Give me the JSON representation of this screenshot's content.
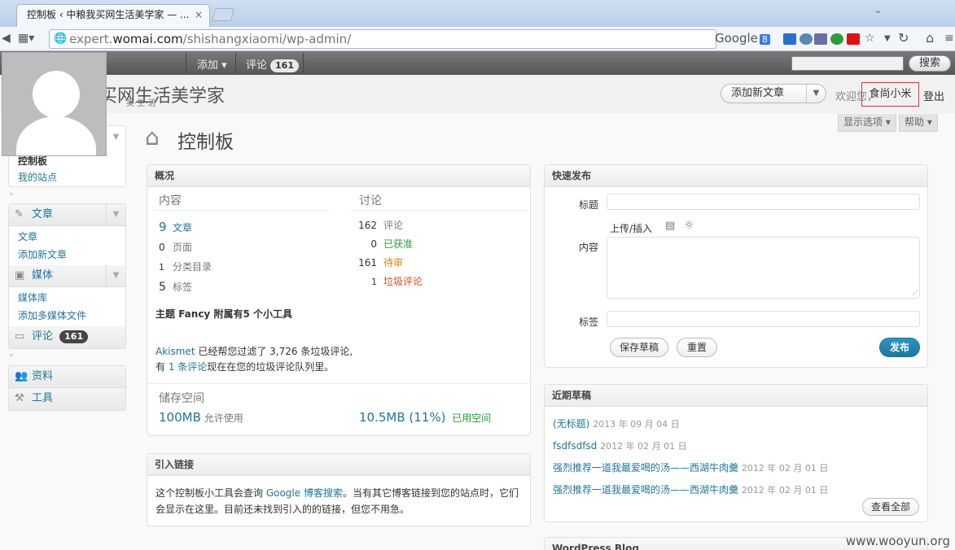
{
  "browser": {
    "tab_title": "控制板 ‹ 中粮我买网生活美学家 — ...",
    "tab_close": "×",
    "url_prefix": "expert.",
    "url_domain": "womai.com",
    "url_path": "/shishangxiaomi/wp-admin/",
    "search_engine": "Google",
    "search_badge": "8"
  },
  "adminbar": {
    "add": "添加 ▾",
    "comments": "评论",
    "comments_count": "161",
    "search_button": "搜索"
  },
  "header": {
    "site_title": "买网生活美学家",
    "site_subtitle": "美·生·活",
    "favorite_action": "添加新文章",
    "howdy": "欢迎您，",
    "username": "食尚小米",
    "logout": "登出",
    "screen_options": "显示选项",
    "help": "帮助"
  },
  "page_title": "控制板",
  "sidebar": {
    "dashboard_items": [
      "控制板",
      "我的站点"
    ],
    "posts": {
      "label": "文章",
      "items": [
        "文章",
        "添加新文章"
      ]
    },
    "media": {
      "label": "媒体",
      "items": [
        "媒体库",
        "添加多媒体文件"
      ]
    },
    "comments": {
      "label": "评论",
      "count": "161"
    },
    "profile": "资料",
    "tools": "工具"
  },
  "right_now": {
    "title": "概况",
    "content_head": "内容",
    "discussion_head": "讨论",
    "content": [
      {
        "count": "9",
        "label": "文章"
      },
      {
        "count": "0",
        "label": "页面"
      },
      {
        "count": "1",
        "label": "分类目录"
      },
      {
        "count": "5",
        "label": "标签"
      }
    ],
    "discussion": [
      {
        "count": "162",
        "label": "评论"
      },
      {
        "count": "0",
        "label": "已获准"
      },
      {
        "count": "161",
        "label": "待审"
      },
      {
        "count": "1",
        "label": "垃圾评论"
      }
    ],
    "theme_prefix": "主题 ",
    "theme_name": "Fancy",
    "theme_suffix": " 附属有",
    "widgets_link": "5 个小工具",
    "akismet": "Akismet",
    "akismet_text": " 已经帮您过滤了 3,726 条垃圾评论,",
    "spam_prefix": "有 ",
    "spam_link": "1 条评论",
    "spam_suffix": "现在在您的垃圾评论队列里。",
    "storage_head": "储存空间",
    "storage_allowed": "100MB",
    "storage_allowed_label": "允许使用",
    "storage_used": "10.5MB (11%)",
    "storage_used_label": "已用空间"
  },
  "incoming_links": {
    "title": "引入链接",
    "text_before": "这个控制板小工具会查询 ",
    "link": "Google 博客搜索",
    "text_after": "。当有其它博客链接到您的站点时，它们会显示在这里。目前还未找到引入的的链接，但您不用急。"
  },
  "quick_press": {
    "title": "快速发布",
    "title_label": "标题",
    "upload_label": "上传/插入",
    "content_label": "内容",
    "tags_label": "标签",
    "save_draft": "保存草稿",
    "reset": "重置",
    "publish": "发布"
  },
  "recent_drafts": {
    "title": "近期草稿",
    "items": [
      {
        "title": "(无标题)",
        "date": "2013 年 09 月 04 日"
      },
      {
        "title": "fsdfsdfsd",
        "date": "2012 年 02 月 01 日"
      },
      {
        "title": "强烈推荐一道我最爱喝的汤——西湖牛肉羹",
        "date": "2012 年 02 月 01 日"
      },
      {
        "title": "强烈推荐一道我最爱喝的汤——西湖牛肉羹",
        "date": "2012 年 02 月 01 日"
      }
    ],
    "view_all": "查看全部"
  },
  "wp_blog": {
    "title": "WordPress Blog"
  },
  "watermark": "www.wooyun.org"
}
